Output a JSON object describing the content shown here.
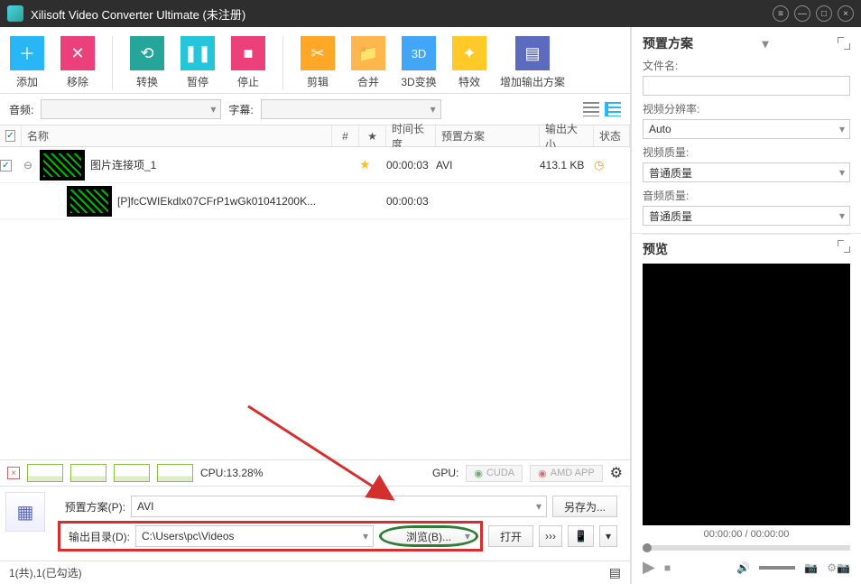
{
  "window": {
    "title": "Xilisoft Video Converter Ultimate (未注册)"
  },
  "toolbar": {
    "add": "添加",
    "remove": "移除",
    "convert": "转换",
    "pause": "暂停",
    "stop": "停止",
    "clip": "剪辑",
    "merge": "合并",
    "threed": "3D变换",
    "effect": "特效",
    "addprofile": "增加输出方案"
  },
  "subtb": {
    "audio": "音频:",
    "subtitle": "字幕:"
  },
  "columns": {
    "name": "名称",
    "seq": "#",
    "star": "★",
    "duration": "时间长度",
    "preset": "预置方案",
    "size": "输出大小",
    "status": "状态"
  },
  "rows": [
    {
      "name": "图片连接项_1",
      "duration": "00:00:03",
      "preset": "AVI",
      "size": "413.1 KB",
      "starred": true,
      "expanded": true
    },
    {
      "name": "[P]fcCWIEkdlx07CFrP1wGk01041200K...",
      "duration": "00:00:03",
      "child": true
    }
  ],
  "cpu": {
    "label": "CPU:13.28%",
    "gpu": "GPU:",
    "cuda": "CUDA",
    "amd": "AMD APP"
  },
  "output": {
    "preset_lbl": "预置方案(P):",
    "preset_val": "AVI",
    "saveas": "另存为...",
    "dir_lbl": "输出目录(D):",
    "dir_val": "C:\\Users\\pc\\Videos",
    "browse": "浏览(B)...",
    "open": "打开",
    "more": "›››"
  },
  "statusbar": {
    "text": "1(共),1(已勾选)"
  },
  "right": {
    "preset_title": "预置方案",
    "filename": "文件名:",
    "resolution": "视频分辨率:",
    "resolution_val": "Auto",
    "vquality": "视频质量:",
    "vquality_val": "普通质量",
    "aquality": "音频质量:",
    "aquality_val": "普通质量",
    "preview": "预览",
    "time": "00:00:00 / 00:00:00"
  }
}
